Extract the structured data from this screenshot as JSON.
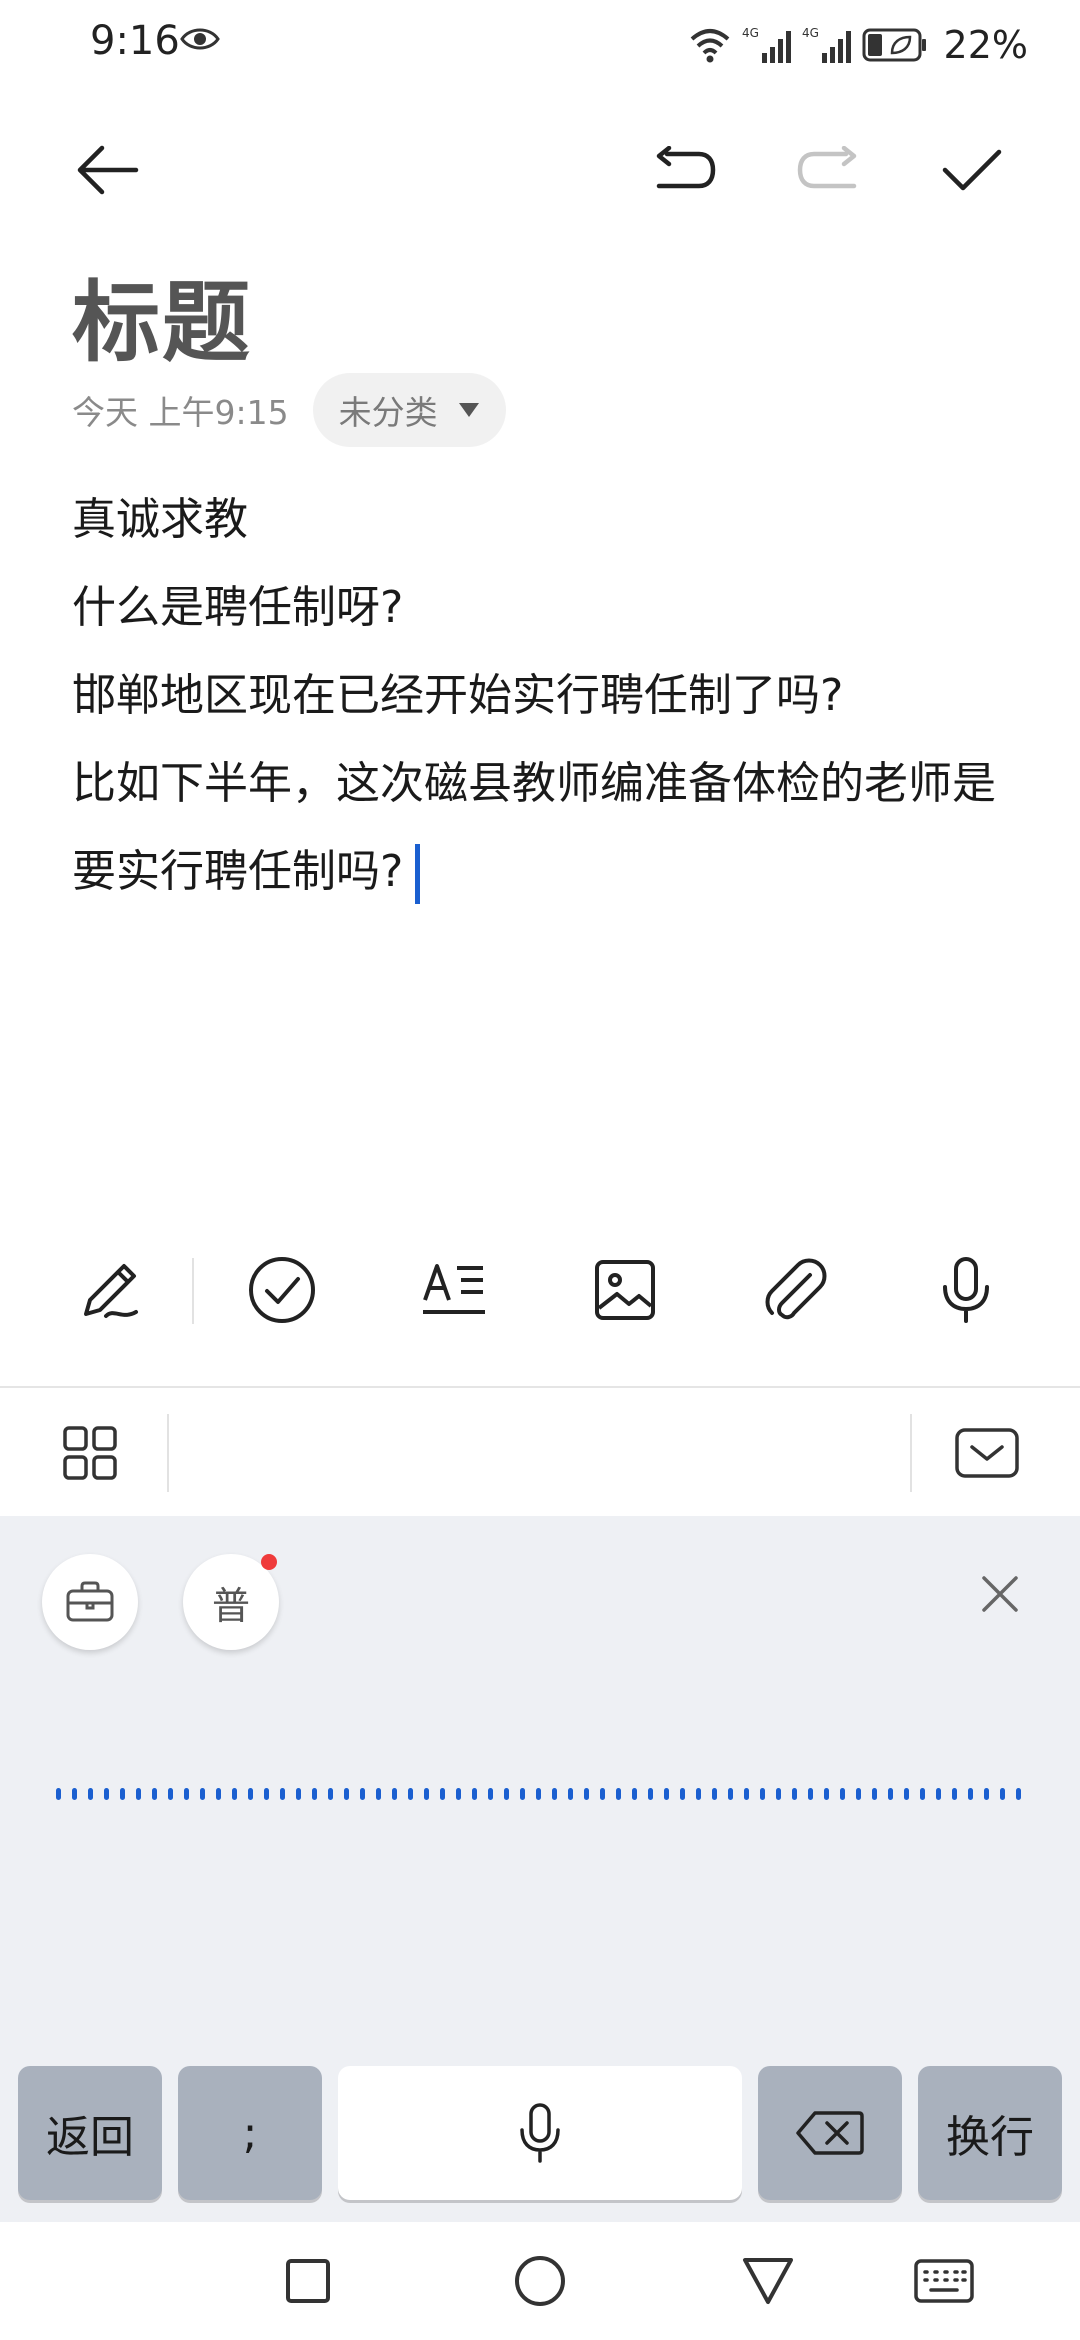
{
  "status": {
    "time": "9:16",
    "network_left": "4G",
    "network_right": "4G",
    "battery": "22%"
  },
  "note": {
    "title": "标题",
    "date": "今天 上午9:15",
    "category": "未分类",
    "lines": [
      "真诚求教",
      "什么是聘任制呀?",
      "邯郸地区现在已经开始实行聘任制了吗?",
      "比如下半年，这次磁县教师编准备体检的老师是要实行聘任制吗?"
    ]
  },
  "voice_panel": {
    "mode_label": "普"
  },
  "keys": {
    "back": "返回",
    "semicolon": ";",
    "enter": "换行"
  },
  "colors": {
    "accent": "#1a5fd0",
    "badge": "#ef3b3b",
    "panel_bg": "#eef0f4",
    "key_gray": "#a9b1bd"
  }
}
